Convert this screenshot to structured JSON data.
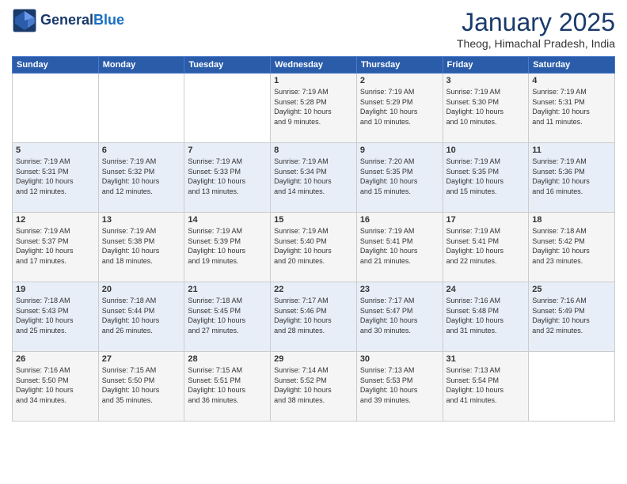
{
  "header": {
    "logo_line1": "General",
    "logo_line2": "Blue",
    "title": "January 2025",
    "subtitle": "Theog, Himachal Pradesh, India"
  },
  "weekdays": [
    "Sunday",
    "Monday",
    "Tuesday",
    "Wednesday",
    "Thursday",
    "Friday",
    "Saturday"
  ],
  "weeks": [
    [
      {
        "day": "",
        "info": ""
      },
      {
        "day": "",
        "info": ""
      },
      {
        "day": "",
        "info": ""
      },
      {
        "day": "1",
        "info": "Sunrise: 7:19 AM\nSunset: 5:28 PM\nDaylight: 10 hours\nand 9 minutes."
      },
      {
        "day": "2",
        "info": "Sunrise: 7:19 AM\nSunset: 5:29 PM\nDaylight: 10 hours\nand 10 minutes."
      },
      {
        "day": "3",
        "info": "Sunrise: 7:19 AM\nSunset: 5:30 PM\nDaylight: 10 hours\nand 10 minutes."
      },
      {
        "day": "4",
        "info": "Sunrise: 7:19 AM\nSunset: 5:31 PM\nDaylight: 10 hours\nand 11 minutes."
      }
    ],
    [
      {
        "day": "5",
        "info": "Sunrise: 7:19 AM\nSunset: 5:31 PM\nDaylight: 10 hours\nand 12 minutes."
      },
      {
        "day": "6",
        "info": "Sunrise: 7:19 AM\nSunset: 5:32 PM\nDaylight: 10 hours\nand 12 minutes."
      },
      {
        "day": "7",
        "info": "Sunrise: 7:19 AM\nSunset: 5:33 PM\nDaylight: 10 hours\nand 13 minutes."
      },
      {
        "day": "8",
        "info": "Sunrise: 7:19 AM\nSunset: 5:34 PM\nDaylight: 10 hours\nand 14 minutes."
      },
      {
        "day": "9",
        "info": "Sunrise: 7:20 AM\nSunset: 5:35 PM\nDaylight: 10 hours\nand 15 minutes."
      },
      {
        "day": "10",
        "info": "Sunrise: 7:19 AM\nSunset: 5:35 PM\nDaylight: 10 hours\nand 15 minutes."
      },
      {
        "day": "11",
        "info": "Sunrise: 7:19 AM\nSunset: 5:36 PM\nDaylight: 10 hours\nand 16 minutes."
      }
    ],
    [
      {
        "day": "12",
        "info": "Sunrise: 7:19 AM\nSunset: 5:37 PM\nDaylight: 10 hours\nand 17 minutes."
      },
      {
        "day": "13",
        "info": "Sunrise: 7:19 AM\nSunset: 5:38 PM\nDaylight: 10 hours\nand 18 minutes."
      },
      {
        "day": "14",
        "info": "Sunrise: 7:19 AM\nSunset: 5:39 PM\nDaylight: 10 hours\nand 19 minutes."
      },
      {
        "day": "15",
        "info": "Sunrise: 7:19 AM\nSunset: 5:40 PM\nDaylight: 10 hours\nand 20 minutes."
      },
      {
        "day": "16",
        "info": "Sunrise: 7:19 AM\nSunset: 5:41 PM\nDaylight: 10 hours\nand 21 minutes."
      },
      {
        "day": "17",
        "info": "Sunrise: 7:19 AM\nSunset: 5:41 PM\nDaylight: 10 hours\nand 22 minutes."
      },
      {
        "day": "18",
        "info": "Sunrise: 7:18 AM\nSunset: 5:42 PM\nDaylight: 10 hours\nand 23 minutes."
      }
    ],
    [
      {
        "day": "19",
        "info": "Sunrise: 7:18 AM\nSunset: 5:43 PM\nDaylight: 10 hours\nand 25 minutes."
      },
      {
        "day": "20",
        "info": "Sunrise: 7:18 AM\nSunset: 5:44 PM\nDaylight: 10 hours\nand 26 minutes."
      },
      {
        "day": "21",
        "info": "Sunrise: 7:18 AM\nSunset: 5:45 PM\nDaylight: 10 hours\nand 27 minutes."
      },
      {
        "day": "22",
        "info": "Sunrise: 7:17 AM\nSunset: 5:46 PM\nDaylight: 10 hours\nand 28 minutes."
      },
      {
        "day": "23",
        "info": "Sunrise: 7:17 AM\nSunset: 5:47 PM\nDaylight: 10 hours\nand 30 minutes."
      },
      {
        "day": "24",
        "info": "Sunrise: 7:16 AM\nSunset: 5:48 PM\nDaylight: 10 hours\nand 31 minutes."
      },
      {
        "day": "25",
        "info": "Sunrise: 7:16 AM\nSunset: 5:49 PM\nDaylight: 10 hours\nand 32 minutes."
      }
    ],
    [
      {
        "day": "26",
        "info": "Sunrise: 7:16 AM\nSunset: 5:50 PM\nDaylight: 10 hours\nand 34 minutes."
      },
      {
        "day": "27",
        "info": "Sunrise: 7:15 AM\nSunset: 5:50 PM\nDaylight: 10 hours\nand 35 minutes."
      },
      {
        "day": "28",
        "info": "Sunrise: 7:15 AM\nSunset: 5:51 PM\nDaylight: 10 hours\nand 36 minutes."
      },
      {
        "day": "29",
        "info": "Sunrise: 7:14 AM\nSunset: 5:52 PM\nDaylight: 10 hours\nand 38 minutes."
      },
      {
        "day": "30",
        "info": "Sunrise: 7:13 AM\nSunset: 5:53 PM\nDaylight: 10 hours\nand 39 minutes."
      },
      {
        "day": "31",
        "info": "Sunrise: 7:13 AM\nSunset: 5:54 PM\nDaylight: 10 hours\nand 41 minutes."
      },
      {
        "day": "",
        "info": ""
      }
    ]
  ]
}
